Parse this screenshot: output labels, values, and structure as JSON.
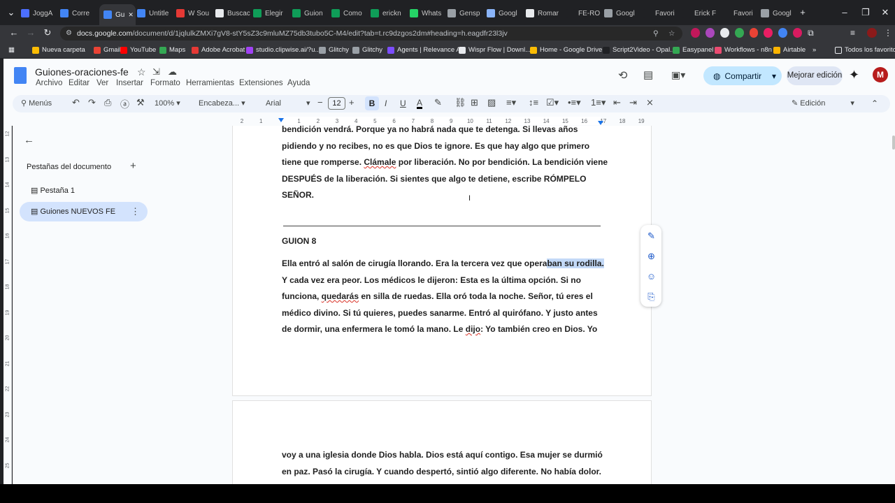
{
  "browser": {
    "tabs": [
      {
        "label": "JoggA",
        "color": "#4c6fff"
      },
      {
        "label": "Corre",
        "color": "#4285f4"
      },
      {
        "label": "Gu",
        "color": "#4285f4",
        "active": true
      },
      {
        "label": "Untitle",
        "color": "#4285f4"
      },
      {
        "label": "W Sou",
        "color": "#e53935"
      },
      {
        "label": "Buscac",
        "color": "#e8eaed"
      },
      {
        "label": "Elegir",
        "color": "#0f9d58"
      },
      {
        "label": "Guion",
        "color": "#0f9d58"
      },
      {
        "label": "Como",
        "color": "#0f9d58"
      },
      {
        "label": "erickn",
        "color": "#0f9d58"
      },
      {
        "label": "Whats",
        "color": "#25d366"
      },
      {
        "label": "Gensp",
        "color": "#9aa0a6"
      },
      {
        "label": "Googl",
        "color": "#8ab4f8"
      },
      {
        "label": "Romar",
        "color": "#e8eaed"
      },
      {
        "label": "FE-RO",
        "color": "#202124"
      },
      {
        "label": "Googl",
        "color": "#9aa0a6"
      },
      {
        "label": "Favori",
        "color": "#202124"
      },
      {
        "label": "Erick F",
        "color": "#202124"
      },
      {
        "label": "Favori",
        "color": "#202124"
      },
      {
        "label": "Googl",
        "color": "#9aa0a6"
      }
    ],
    "new_tab": "+",
    "url_host": "docs.google.com",
    "url_path": "/document/d/1jqlulkZMXi7gV8-stY5sZ3c9mluMZ75db3tubo5C-M4/edit?tab=t.rc9dzgos2dm#heading=h.eagdfr23l3jv",
    "bookmarks": [
      {
        "label": "Nueva carpeta",
        "color": "#fbbc04"
      },
      {
        "label": "Gmail",
        "color": "#ea4335"
      },
      {
        "label": "YouTube",
        "color": "#ff0000"
      },
      {
        "label": "Maps",
        "color": "#34a853"
      },
      {
        "label": "Adobe Acrobat",
        "color": "#e53935"
      },
      {
        "label": "studio.clipwise.ai/?u...",
        "color": "#a142f4"
      },
      {
        "label": "Glitchy",
        "color": "#9aa0a6"
      },
      {
        "label": "Glitchy",
        "color": "#9aa0a6"
      },
      {
        "label": "Agents | Relevance AI",
        "color": "#7c4dff"
      },
      {
        "label": "Wispr Flow | Downl...",
        "color": "#e8eaed"
      },
      {
        "label": "Home - Google Drive",
        "color": "#fbbc04"
      },
      {
        "label": "Script2Video - Opal...",
        "color": "#202124"
      },
      {
        "label": "Easypanel",
        "color": "#34a853"
      },
      {
        "label": "Workflows - n8n",
        "color": "#ea4b71"
      },
      {
        "label": "Airtable",
        "color": "#fcb400"
      }
    ],
    "bookmarks_more": "»",
    "all_favorites": "Todos los favoritos"
  },
  "docs": {
    "title": "Guiones-oraciones-fe",
    "menus": [
      "Archivo",
      "Editar",
      "Ver",
      "Insertar",
      "Formato",
      "Herramientas",
      "Extensiones",
      "Ayuda"
    ],
    "share": "Compartir",
    "improve": "Mejorar edición",
    "search_menus": "Menús",
    "zoom": "100%",
    "style": "Encabeza...",
    "font": "Arial",
    "font_size": "12",
    "mode": "Edición",
    "ruler_numbers": [
      "2",
      "1",
      "",
      "1",
      "2",
      "3",
      "4",
      "5",
      "6",
      "7",
      "8",
      "9",
      "10",
      "11",
      "12",
      "13",
      "14",
      "15",
      "16",
      "17",
      "18",
      "19"
    ],
    "vruler_numbers": [
      "12",
      "13",
      "14",
      "15",
      "16",
      "17",
      "18",
      "19",
      "20",
      "21",
      "22",
      "23",
      "24",
      "25"
    ]
  },
  "sidebar": {
    "header": "Pestañas del documento",
    "add": "+",
    "tabs": [
      {
        "label": "Pestaña 1"
      },
      {
        "label": "Guiones NUEVOS FE",
        "selected": true
      }
    ]
  },
  "doc": {
    "para_top_1": "bendición vendrá. Porque ya no habrá nada que te detenga. Si llevas años",
    "para_top_2": "pidiendo y no recibes, no es que Dios te ignore. Es que hay algo que primero",
    "para_top_3a": "tiene que romperse. ",
    "para_top_3b": "Clámale",
    "para_top_3c": " por liberación. No por bendición. La bendición viene",
    "para_top_4": "DESPUÉS de la liberación. Si sientes que algo te detiene, escribe RÓMPELO",
    "para_top_5": "SEÑOR.",
    "heading": "GUION 8",
    "g8_1a": "Ella entró al salón de cirugía llorando. Era la tercera vez que opera",
    "g8_1b": "ban su rodilla.",
    "g8_2": "Y cada vez era peor. Los médicos le dijeron: Esta es la última opción. Si no",
    "g8_3a": "funciona, ",
    "g8_3b": "quedarás",
    "g8_3c": " en silla de ruedas. Ella oró toda la noche. Señor, tú eres el",
    "g8_4": "médico divino. Si tú quieres, puedes sanarme. Entró al quirófano. Y justo antes",
    "g8_5a": "de dormir, una enfermera le tomó la mano. Le ",
    "g8_5b": "dijo",
    "g8_5c": ": Yo también creo en Dios. Yo",
    "p2_1": "voy a una iglesia donde Dios habla. Dios está aquí contigo. Esa mujer se durmió",
    "p2_2": "en paz. Pasó la cirugía. Y cuando despertó, sintió algo diferente. No había dolor."
  }
}
